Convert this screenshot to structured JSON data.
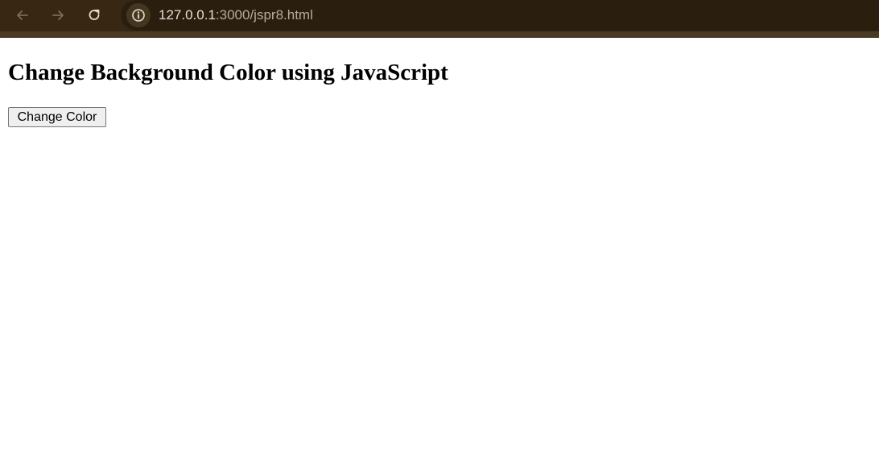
{
  "browser": {
    "url_host": "127.0.0.1",
    "url_rest": ":3000/jspr8.html",
    "icons": [
      "back-arrow-icon",
      "forward-arrow-icon",
      "reload-icon",
      "info-icon"
    ]
  },
  "page": {
    "title": "Change Background Color using JavaScript",
    "button_label": "Change Color"
  },
  "colors": {
    "toolbar_bg": "#382713",
    "page_bg": "#ffffff"
  }
}
